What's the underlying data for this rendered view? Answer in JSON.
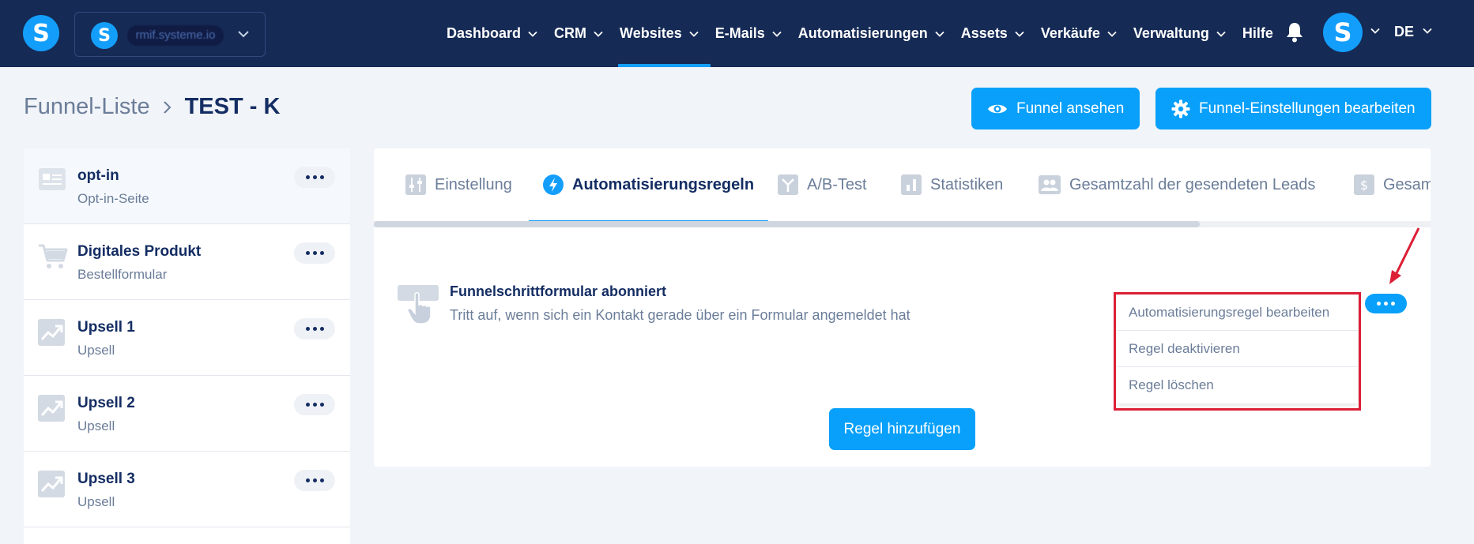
{
  "nav": {
    "logo_letter": "S",
    "workspace": {
      "logo_letter": "S",
      "name": "rmif.systeme.io"
    },
    "items": [
      {
        "label": "Dashboard",
        "active": false
      },
      {
        "label": "CRM",
        "active": false
      },
      {
        "label": "Websites",
        "active": true
      },
      {
        "label": "E-Mails",
        "active": false
      },
      {
        "label": "Automatisierungen",
        "active": false
      },
      {
        "label": "Assets",
        "active": false
      },
      {
        "label": "Verkäufe",
        "active": false
      },
      {
        "label": "Verwaltung",
        "active": false
      }
    ],
    "help": "Hilfe",
    "avatar_letter": "S",
    "language": "DE"
  },
  "header": {
    "breadcrumb_parent": "Funnel-Liste",
    "breadcrumb_current": "TEST - K",
    "view_funnel": "Funnel ansehen",
    "edit_settings": "Funnel-Einstellungen bearbeiten"
  },
  "sidebar": {
    "steps": [
      {
        "title": "opt-in",
        "subtitle": "Opt-in-Seite",
        "icon": "form-page-icon",
        "selected": true
      },
      {
        "title": "Digitales Produkt",
        "subtitle": "Bestellformular",
        "icon": "cart-icon",
        "selected": false
      },
      {
        "title": "Upsell 1",
        "subtitle": "Upsell",
        "icon": "trend-up-icon",
        "selected": false
      },
      {
        "title": "Upsell 2",
        "subtitle": "Upsell",
        "icon": "trend-up-icon",
        "selected": false
      },
      {
        "title": "Upsell 3",
        "subtitle": "Upsell",
        "icon": "trend-up-icon",
        "selected": false
      }
    ]
  },
  "tabs": [
    {
      "label": "Einstellung",
      "icon": "sliders-icon",
      "active": false
    },
    {
      "label": "Automatisierungsregeln",
      "icon": "lightning-icon",
      "active": true
    },
    {
      "label": "A/B-Test",
      "icon": "split-icon",
      "active": false
    },
    {
      "label": "Statistiken",
      "icon": "bar-chart-icon",
      "active": false
    },
    {
      "label": "Gesamtzahl der gesendeten Leads",
      "icon": "users-icon",
      "active": false
    },
    {
      "label": "Gesamtumsatz",
      "icon": "dollar-icon",
      "active": false
    }
  ],
  "rule": {
    "title": "Funnelschrittformular abonniert",
    "description": "Tritt auf, wenn sich ein Kontakt gerade über ein Formular angemeldet hat"
  },
  "rule_menu": {
    "items": [
      "Automatisierungsregel bearbeiten",
      "Regel deaktivieren",
      "Regel löschen"
    ]
  },
  "add_rule": "Regel hinzufügen",
  "colors": {
    "nav_bg": "#152a55",
    "accent": "#149efc",
    "button": "#08a0fa",
    "highlight": "#dc1f36",
    "text_dark": "#142d63",
    "text_muted": "#6b7d99"
  }
}
